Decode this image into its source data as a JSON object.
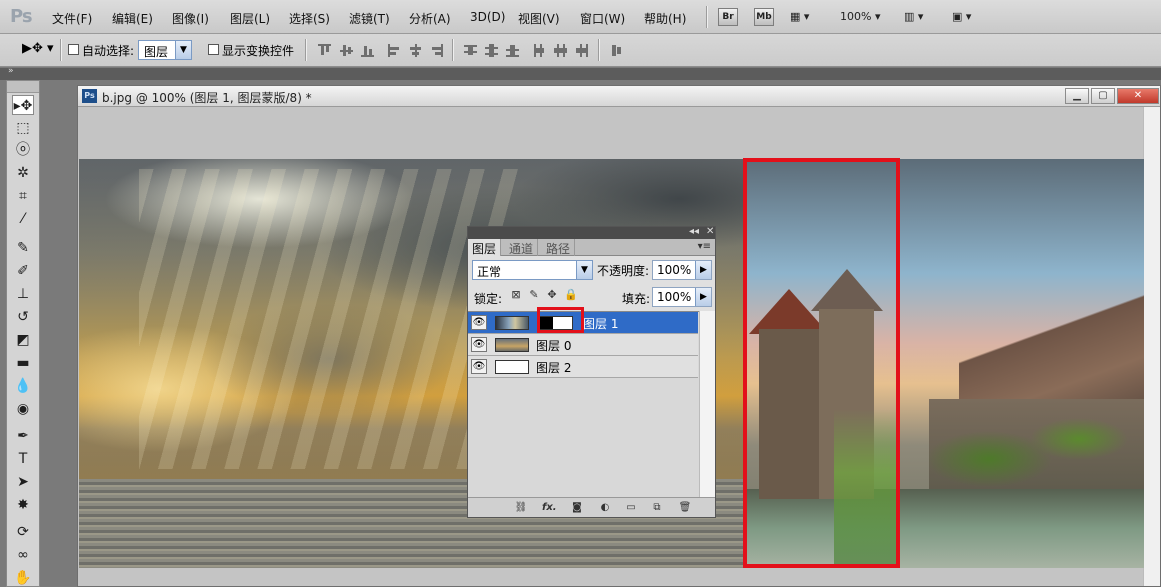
{
  "app": {
    "logo": "Ps"
  },
  "menu": [
    "文件(F)",
    "编辑(E)",
    "图像(I)",
    "图层(L)",
    "选择(S)",
    "滤镜(T)",
    "分析(A)",
    "3D(D)",
    "视图(V)",
    "窗口(W)",
    "帮助(H)"
  ],
  "menubar_right": {
    "br": "Br",
    "mb": "Mb",
    "zoom": "100%"
  },
  "options": {
    "auto_select_label": "自动选择:",
    "auto_select_value": "图层",
    "show_transform_label": "显示变换控件"
  },
  "document": {
    "title": "b.jpg @ 100% (图层 1, 图层蒙版/8) *",
    "icon": "Ps"
  },
  "layers_panel": {
    "tabs": [
      "图层",
      "通道",
      "路径"
    ],
    "blend_mode": "正常",
    "opacity_label": "不透明度:",
    "opacity_value": "100%",
    "lock_label": "锁定:",
    "fill_label": "填充:",
    "fill_value": "100%",
    "layers": [
      {
        "name": "图层 1",
        "selected": true,
        "has_mask": true
      },
      {
        "name": "图层 0",
        "selected": false,
        "has_mask": false
      },
      {
        "name": "图层 2",
        "selected": false,
        "has_mask": false
      }
    ],
    "footer_icons": [
      "link-icon",
      "fx-icon",
      "mask-icon",
      "adjustment-icon",
      "group-icon",
      "new-layer-icon",
      "trash-icon"
    ],
    "footer_fx": "fx."
  },
  "highlight_color": "#e3101a",
  "selected_layer_color": "#2f6bc7"
}
